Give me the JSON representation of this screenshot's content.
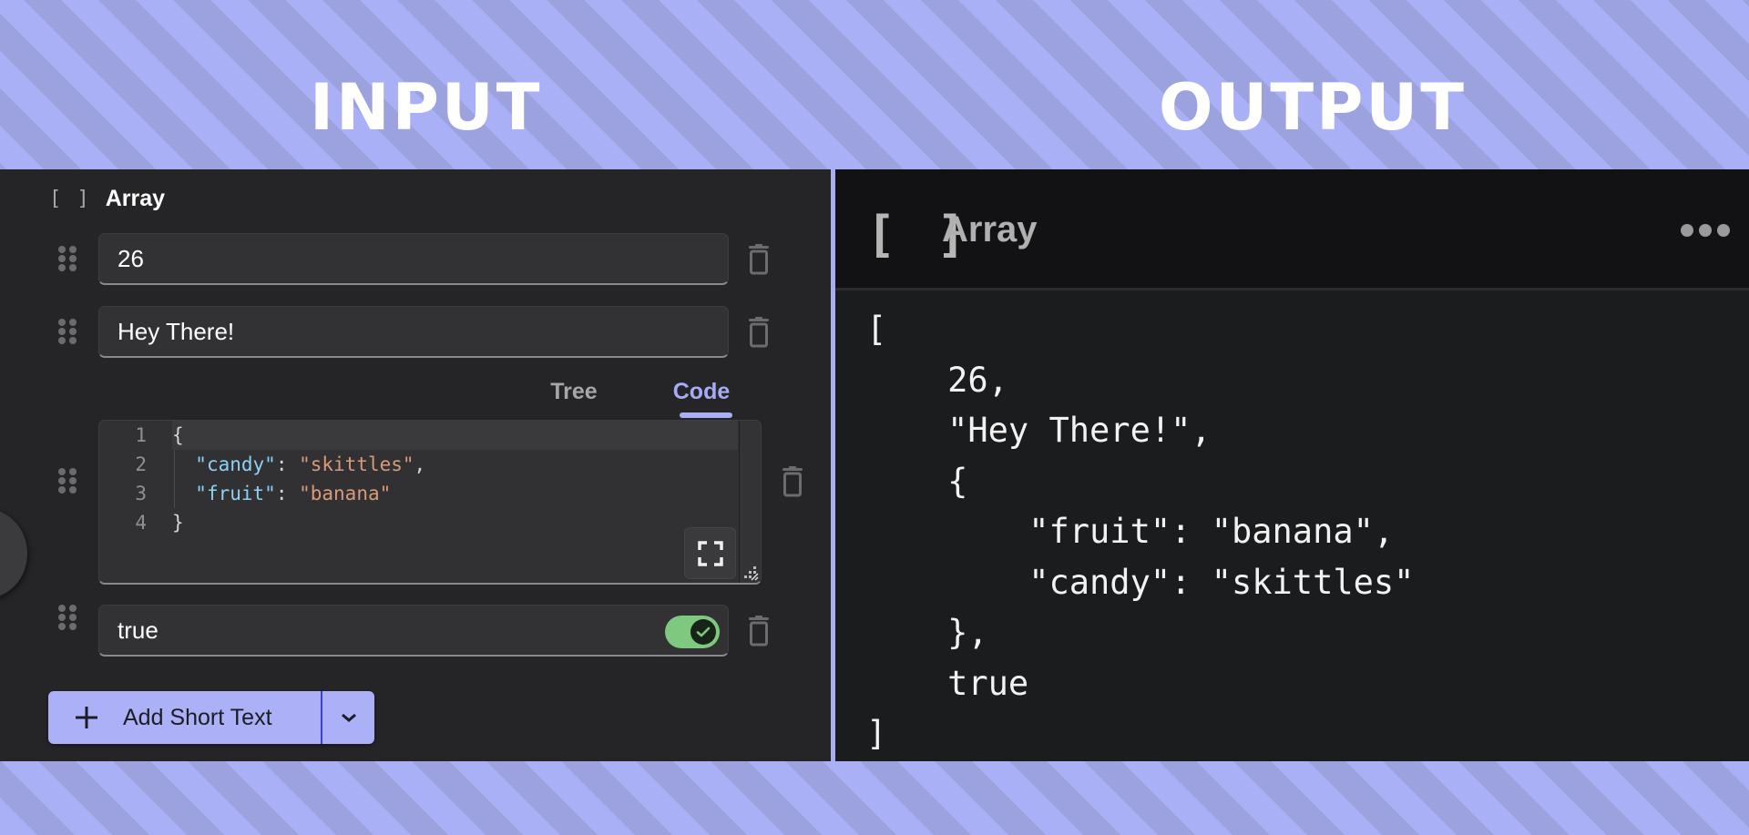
{
  "headings": {
    "input": "INPUT",
    "output": "OUTPUT"
  },
  "colors": {
    "stripe_light": "#aab0f6",
    "stripe_dark": "#9ca2de",
    "accent": "#a9aef6",
    "toggle_on": "#7ec87f",
    "json_key": "#8fd0f5",
    "json_string": "#d99a7a"
  },
  "input_panel": {
    "array_header": {
      "icon": "brackets-icon",
      "icon_glyph": "[ ]",
      "label": "Array"
    },
    "items": [
      {
        "type": "number",
        "value": "26"
      },
      {
        "type": "text",
        "value": "Hey There!"
      },
      {
        "type": "object",
        "tabs": [
          {
            "label": "Tree",
            "active": false
          },
          {
            "label": "Code",
            "active": true
          }
        ],
        "code_lines": [
          {
            "number": "1",
            "tokens": [
              {
                "t": "punc",
                "v": "{"
              }
            ]
          },
          {
            "number": "2",
            "tokens": [
              {
                "t": "punc",
                "v": "  "
              },
              {
                "t": "key",
                "v": "\"candy\""
              },
              {
                "t": "punc",
                "v": ": "
              },
              {
                "t": "str",
                "v": "\"skittles\""
              },
              {
                "t": "punc",
                "v": ","
              }
            ]
          },
          {
            "number": "3",
            "tokens": [
              {
                "t": "punc",
                "v": "  "
              },
              {
                "t": "key",
                "v": "\"fruit\""
              },
              {
                "t": "punc",
                "v": ": "
              },
              {
                "t": "str",
                "v": "\"banana\""
              }
            ]
          },
          {
            "number": "4",
            "tokens": [
              {
                "t": "punc",
                "v": "}"
              }
            ]
          }
        ]
      },
      {
        "type": "boolean",
        "value": "true",
        "toggle_on": true
      }
    ],
    "add_button": {
      "label": "Add Short Text",
      "icon": "plus-icon"
    }
  },
  "output_panel": {
    "header": {
      "icon": "brackets-icon",
      "icon_glyph": "[ ]",
      "label": "Array"
    },
    "json_lines": [
      "[",
      "    26,",
      "    \"Hey There!\",",
      "    {",
      "        \"fruit\": \"banana\",",
      "        \"candy\": \"skittles\"",
      "    },",
      "    true",
      "]"
    ]
  }
}
